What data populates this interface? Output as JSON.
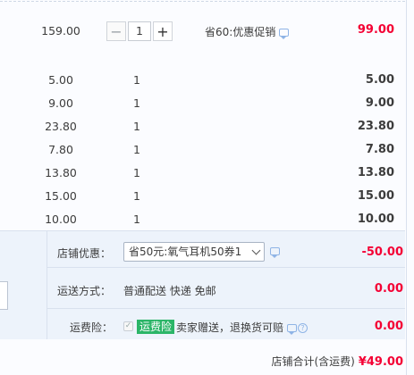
{
  "first_item": {
    "price": "159.00",
    "quantity": "1",
    "promo": "省60:优惠促销",
    "subtotal": "99.00"
  },
  "items": [
    {
      "price": "5.00",
      "quantity": "1",
      "subtotal": "5.00"
    },
    {
      "price": "9.00",
      "quantity": "1",
      "subtotal": "9.00"
    },
    {
      "price": "23.80",
      "quantity": "1",
      "subtotal": "23.80"
    },
    {
      "price": "7.80",
      "quantity": "1",
      "subtotal": "7.80"
    },
    {
      "price": "13.80",
      "quantity": "1",
      "subtotal": "13.80"
    },
    {
      "price": "15.00",
      "quantity": "1",
      "subtotal": "15.00"
    },
    {
      "price": "10.00",
      "quantity": "1",
      "subtotal": "10.00"
    }
  ],
  "shop": {
    "discount_label": "店铺优惠：",
    "discount_selected": "省50元:氧气耳机50券1",
    "discount_amount": "-50.00",
    "shipping_label": "运送方式：",
    "shipping_value": "普通配送 快递 免邮",
    "shipping_amount": "0.00",
    "insurance_label": "运费险：",
    "insurance_tag": "运费险",
    "insurance_text": "卖家赠送，退换货可赔",
    "insurance_amount": "0.00",
    "total_label": "店铺合计(含运费)",
    "total_amount": "¥49.00"
  },
  "icons": {
    "minus": "−",
    "plus": "+",
    "check": "✓",
    "question": "?"
  },
  "colors": {
    "accent_red": "#f40034",
    "tag_green": "#2bb568",
    "panel_bg": "#edf3fb"
  }
}
